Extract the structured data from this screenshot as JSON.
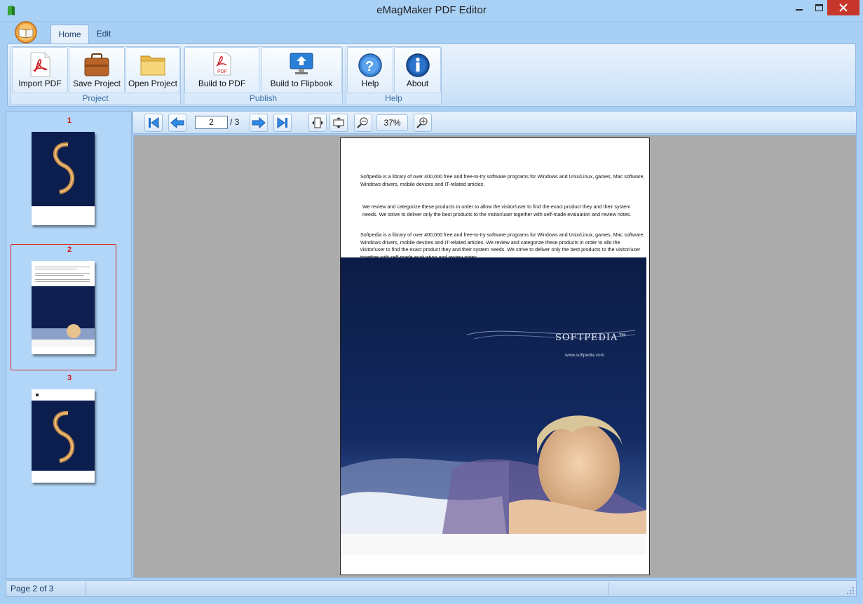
{
  "window": {
    "title": "eMagMaker PDF Editor"
  },
  "ribbon": {
    "tabs": [
      {
        "label": "Home"
      },
      {
        "label": "Edit"
      }
    ],
    "groups": {
      "project": {
        "label": "Project",
        "buttons": [
          {
            "label": "Import PDF",
            "icon": "pdf-document-icon"
          },
          {
            "label": "Save Project",
            "icon": "briefcase-icon"
          },
          {
            "label": "Open Project",
            "icon": "folder-icon"
          }
        ]
      },
      "publish": {
        "label": "Publish",
        "buttons": [
          {
            "label": "Build to PDF",
            "icon": "pdf-file-icon"
          },
          {
            "label": "Build to Flipbook",
            "icon": "monitor-upload-icon"
          }
        ]
      },
      "help": {
        "label": "Help",
        "buttons": [
          {
            "label": "Help",
            "icon": "question-icon"
          },
          {
            "label": "About",
            "icon": "info-icon"
          }
        ]
      }
    }
  },
  "thumbnails": [
    {
      "number": "1"
    },
    {
      "number": "2",
      "selected": true
    },
    {
      "number": "3"
    }
  ],
  "toolbar": {
    "current_page": "2",
    "total_pages": "/ 3",
    "zoom": "37%"
  },
  "page": {
    "paragraph1": "Softpedia is a library of over 400,000 free and free-to-try software programs for Windows and Unix/Linux, games, Mac software, Windows drivers, mobile devices and IT-related articles.",
    "paragraph2": "We review and categorize these products in order to allow the visitor/user to find the exact product they and their system needs. We strive to deliver only the best products to the visitor/user together with self-made evaluation and review notes.",
    "paragraph3": "Softpedia is a library of over 400,000 free and free-to-try software programs for Windows and Unix/Linux, games, Mac software, Windows drivers, mobile devices and IT-related articles.  We review and categorize these products in order to allo the visitor/user to find the exact product they and their system needs. We strive to deliver only the best products to the visitor/user together with self-made evaluation and review notes.",
    "logo_text": "SOFTPEDIA™",
    "url_text": "www.softpedia.com"
  },
  "status": {
    "text": "Page 2 of 3"
  },
  "colors": {
    "accent": "#a9d1f6",
    "selection": "#d63030",
    "page_background": "#0e1f4a"
  }
}
